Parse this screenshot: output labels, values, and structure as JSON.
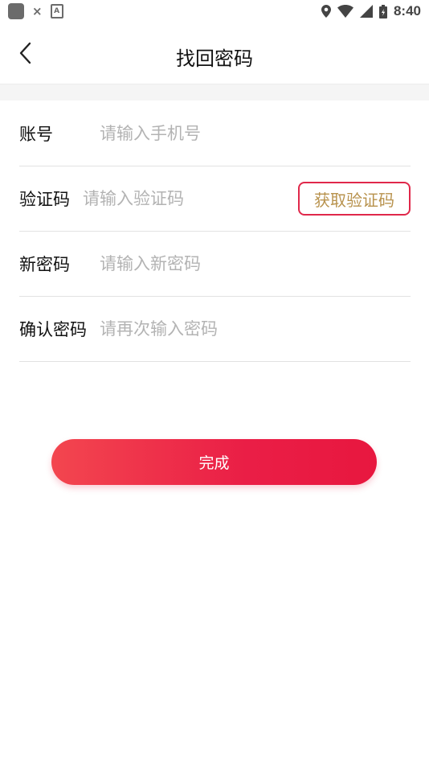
{
  "status_bar": {
    "time": "8:40",
    "left_icons": [
      "app-square-icon",
      "close-icon",
      "keyboard-a-icon"
    ],
    "right_icons": [
      "location-icon",
      "wifi-icon",
      "signal-icon",
      "battery-icon"
    ]
  },
  "header": {
    "back_icon": "chevron-left-icon",
    "title": "找回密码"
  },
  "form": {
    "account": {
      "label": "账号",
      "placeholder": "请输入手机号",
      "value": ""
    },
    "code": {
      "label": "验证码",
      "placeholder": "请输入验证码",
      "value": "",
      "button_label": "获取验证码"
    },
    "new_password": {
      "label": "新密码",
      "placeholder": "请输入新密码",
      "value": ""
    },
    "confirm_password": {
      "label": "确认密码",
      "placeholder": "请再次输入密码",
      "value": ""
    }
  },
  "submit": {
    "label": "完成"
  },
  "colors": {
    "accent": "#e8173f",
    "accent_light": "#f3464f",
    "code_button_text": "#b8924d",
    "code_button_border": "#e0284a",
    "placeholder": "#b3b3b3"
  }
}
